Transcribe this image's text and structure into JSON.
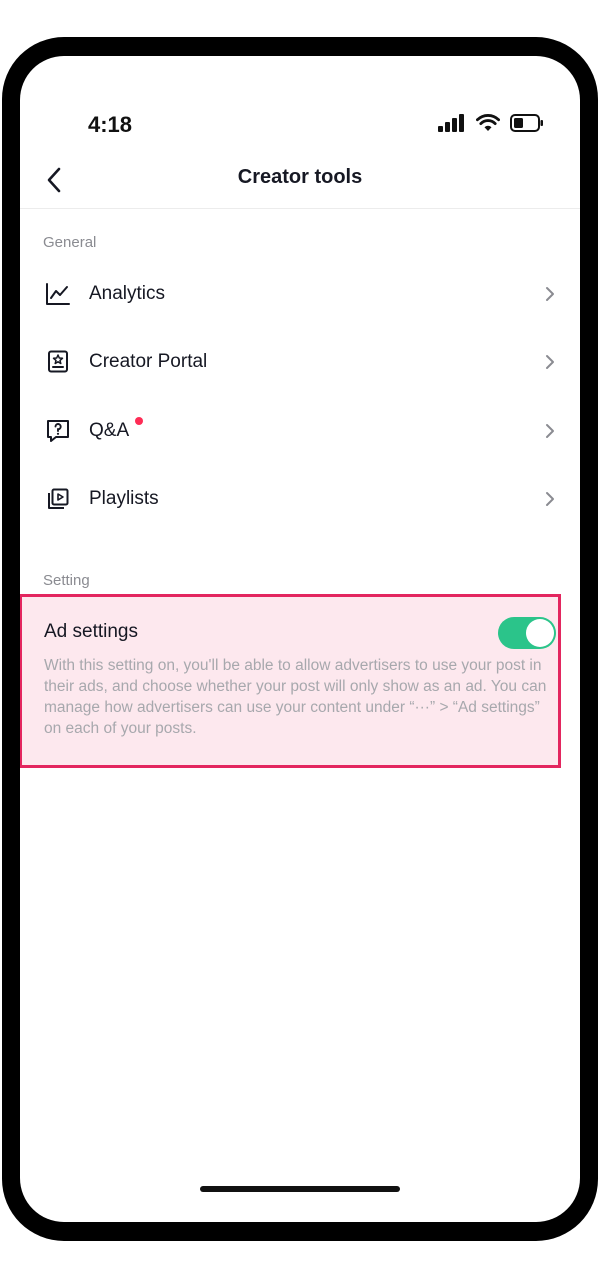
{
  "status_bar": {
    "time": "4:18",
    "icons": [
      "signal-icon",
      "wifi-icon",
      "battery-icon"
    ]
  },
  "nav": {
    "title": "Creator tools",
    "back_icon": "chevron-left-icon"
  },
  "sections": {
    "general": {
      "label": "General",
      "items": [
        {
          "label": "Analytics",
          "icon": "analytics-chart-icon"
        },
        {
          "label": "Creator Portal",
          "icon": "creator-portal-icon"
        },
        {
          "label": "Q&A",
          "icon": "qa-icon",
          "has_badge": true
        },
        {
          "label": "Playlists",
          "icon": "playlists-icon"
        }
      ]
    },
    "setting": {
      "label": "Setting",
      "ad_settings": {
        "title": "Ad settings",
        "enabled": true,
        "description": "With this setting on, you'll be able to allow advertisers to use your post in their ads, and choose whether your post will only show as an ad. You can manage how advertisers can use your content under “···” > “Ad settings” on each of your posts."
      }
    }
  },
  "colors": {
    "toggle_on": "#2bc48a",
    "badge": "#fe2c55",
    "highlight_border": "#e3265f",
    "highlight_fill": "#fde8ee"
  }
}
